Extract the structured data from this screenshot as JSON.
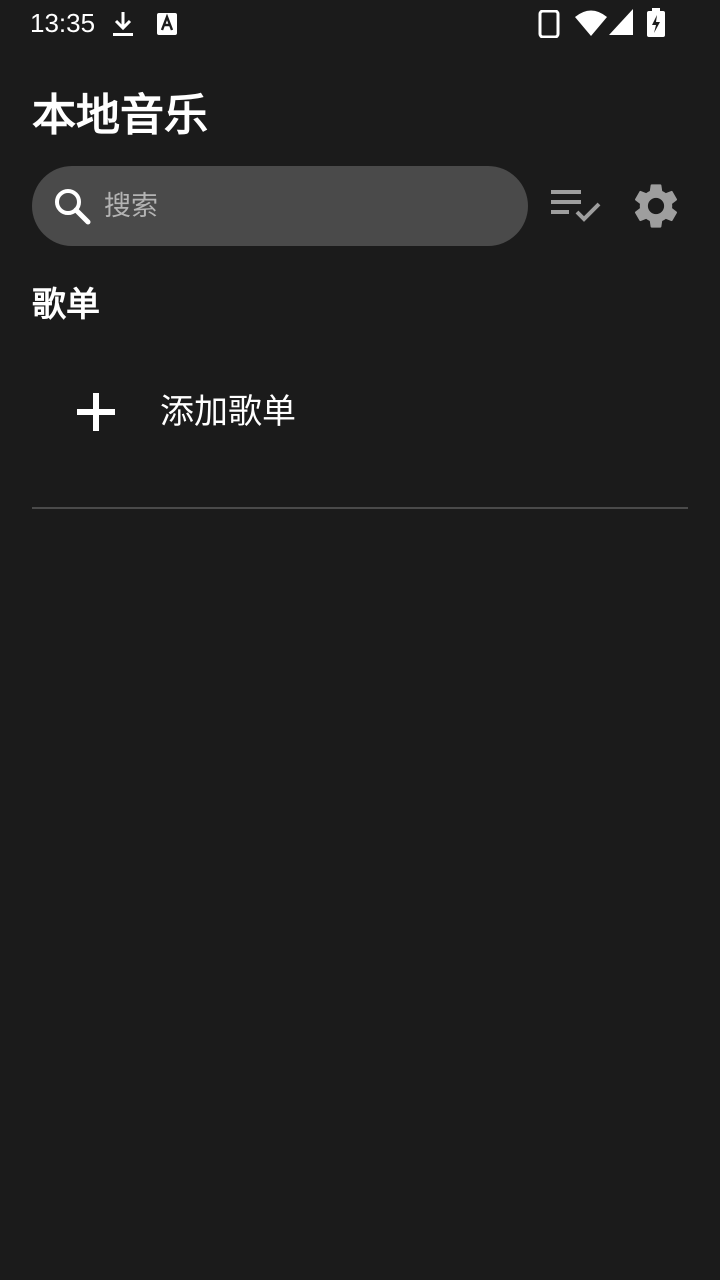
{
  "status_bar": {
    "time": "13:35",
    "icons": [
      "download-icon",
      "keyboard-a-icon",
      "phone-icon",
      "wifi-icon",
      "signal-icon",
      "battery-charging-icon"
    ]
  },
  "header": {
    "title": "本地音乐"
  },
  "search": {
    "placeholder": "搜索",
    "value": ""
  },
  "toolbar": {
    "icons": [
      "playlist-check-icon",
      "settings-gear-icon"
    ]
  },
  "playlists": {
    "section_title": "歌单",
    "add_label": "添加歌单"
  },
  "colors": {
    "background": "#1b1b1b",
    "search_bg": "#4a4a4a",
    "icon_gray": "#9e9e9e",
    "text": "#ffffff",
    "placeholder": "#b4b4b4"
  }
}
